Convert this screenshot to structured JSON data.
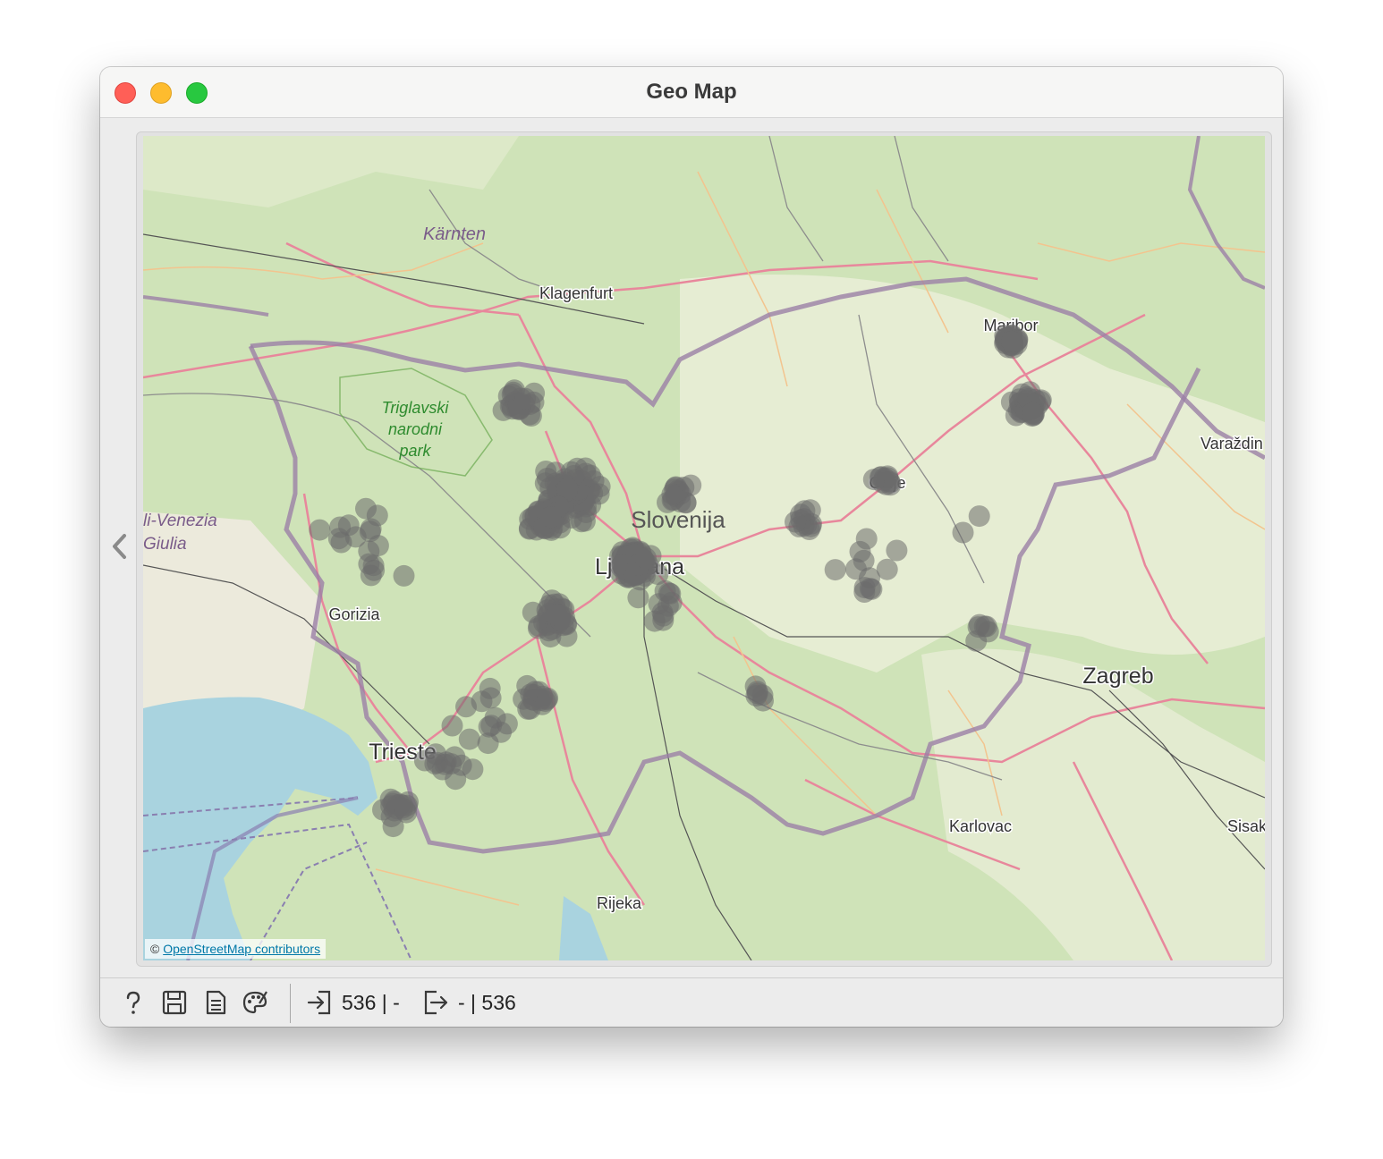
{
  "window": {
    "title": "Geo Map"
  },
  "sidebar_toggle": {
    "icon": "chevron-left-icon"
  },
  "map": {
    "attribution_prefix": "©",
    "attribution_link": "OpenStreetMap contributors",
    "labels": {
      "karnten": "Kärnten",
      "klagenfurt": "Klagenfurt",
      "triglav_1": "Triglavski",
      "triglav_2": "narodni",
      "triglav_3": "park",
      "fvg_1": "li-Venezia",
      "fvg_2": "Giulia",
      "slovenija": "Slovenija",
      "ljubljana": "Ljubljana",
      "gorizia": "Gorizia",
      "trieste": "Trieste",
      "rijeka": "Rijeka",
      "maribor": "Maribor",
      "celje": "Celje",
      "varazdin": "Varaždin",
      "zagreb": "Zagreb",
      "karlovac": "Karlovac",
      "sisak": "Sisak"
    },
    "colors": {
      "point": "#6b6b6b",
      "water": "#a9d3df",
      "land": "#cfe3b8",
      "border": "#9b7fa6",
      "road": "#e8879c"
    },
    "points_total": 536
  },
  "statusbar": {
    "icons": [
      "help-icon",
      "save-icon",
      "report-icon",
      "palette-icon"
    ],
    "input_summary": "536 | -",
    "output_summary": "- | 536"
  }
}
